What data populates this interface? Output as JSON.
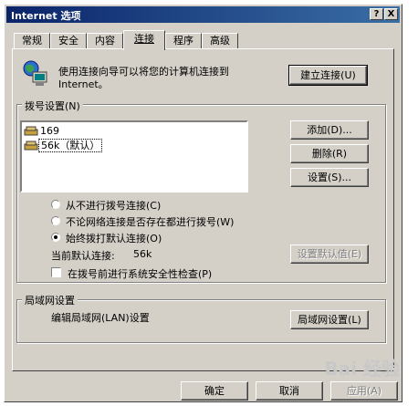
{
  "window": {
    "title": "Internet 选项",
    "help": "?",
    "close": "X"
  },
  "tabs": [
    {
      "label": "常规"
    },
    {
      "label": "安全"
    },
    {
      "label": "内容"
    },
    {
      "label": "连接"
    },
    {
      "label": "程序"
    },
    {
      "label": "高级"
    }
  ],
  "intro": {
    "line1": "使用连接向导可以将您的计算机连接到",
    "line2": "Internet。",
    "setup_button": "建立连接(U)"
  },
  "dialup": {
    "group_label": "拨号设置(N)",
    "connections": [
      {
        "label": "169"
      },
      {
        "label": "56k（默认）"
      }
    ],
    "add_button": "添加(D)...",
    "remove_button": "删除(R)",
    "settings_button": "设置(S)...",
    "radio_never": "从不进行拨号连接(C)",
    "radio_whenever": "不论网络连接是否存在都进行拨号(W)",
    "radio_always": "始终拨打默认连接(O)",
    "radio_selected": "always",
    "current_default_label": "当前默认连接:",
    "current_default_value": "56k",
    "set_default_button": "设置默认值(E)",
    "security_check_label": "在拨号前进行系统安全性检查(P)",
    "security_check_checked": false
  },
  "lan": {
    "group_label": "局域网设置",
    "description": "编辑局域网(LAN)设置",
    "button": "局域网设置(L)"
  },
  "footer": {
    "ok": "确定",
    "cancel": "取消",
    "apply": "应用(A)"
  },
  "watermark": "Bai 经验"
}
